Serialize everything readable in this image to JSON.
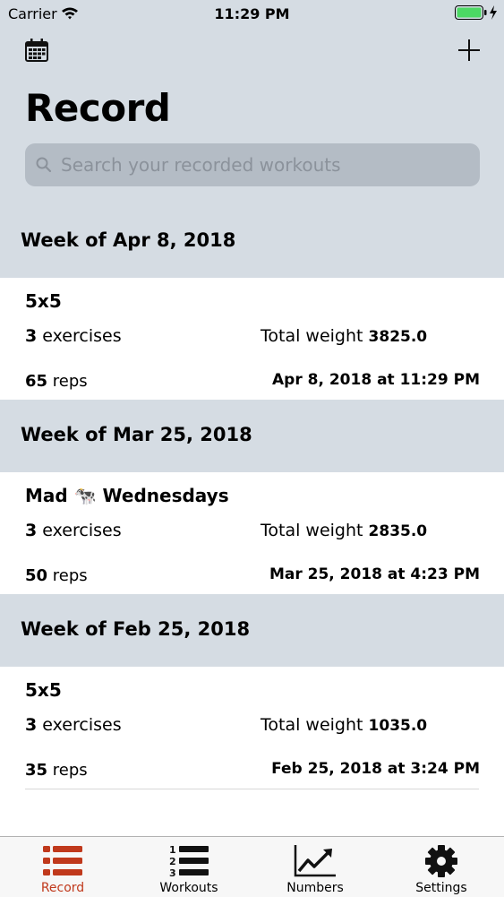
{
  "status_bar": {
    "carrier": "Carrier",
    "time": "11:29 PM"
  },
  "header": {
    "title": "Record",
    "calendar_icon": "calendar-icon",
    "add_icon": "plus-icon"
  },
  "search": {
    "placeholder": "Search your recorded workouts",
    "icon": "search-icon"
  },
  "sections": [
    {
      "header": "Week of Apr 8, 2018",
      "workout": {
        "name": "5x5",
        "exercise_count": "3",
        "exercises_label": "exercises",
        "total_weight_label": "Total weight",
        "total_weight": "3825.0",
        "reps_count": "65",
        "reps_label": "reps",
        "date": "Apr 8, 2018 at 11:29 PM"
      }
    },
    {
      "header": "Week of Mar 25, 2018",
      "workout": {
        "name": "Mad 🐄 Wednesdays",
        "exercise_count": "3",
        "exercises_label": "exercises",
        "total_weight_label": "Total weight",
        "total_weight": "2835.0",
        "reps_count": "50",
        "reps_label": "reps",
        "date": "Mar 25, 2018 at 4:23 PM"
      }
    },
    {
      "header": "Week of Feb 25, 2018",
      "workout": {
        "name": "5x5",
        "exercise_count": "3",
        "exercises_label": "exercises",
        "total_weight_label": "Total weight",
        "total_weight": "1035.0",
        "reps_count": "35",
        "reps_label": "reps",
        "date": "Feb 25, 2018 at 3:24 PM"
      }
    }
  ],
  "tabs": [
    {
      "label": "Record",
      "icon": "list-icon",
      "active": true
    },
    {
      "label": "Workouts",
      "icon": "numbered-list-icon",
      "active": false
    },
    {
      "label": "Numbers",
      "icon": "chart-icon",
      "active": false
    },
    {
      "label": "Settings",
      "icon": "gear-icon",
      "active": false
    }
  ],
  "colors": {
    "header_bg": "#d5dce3",
    "search_bg": "#b4bcc5",
    "active_tab": "#c0391c",
    "inactive_tab": "#111111"
  }
}
